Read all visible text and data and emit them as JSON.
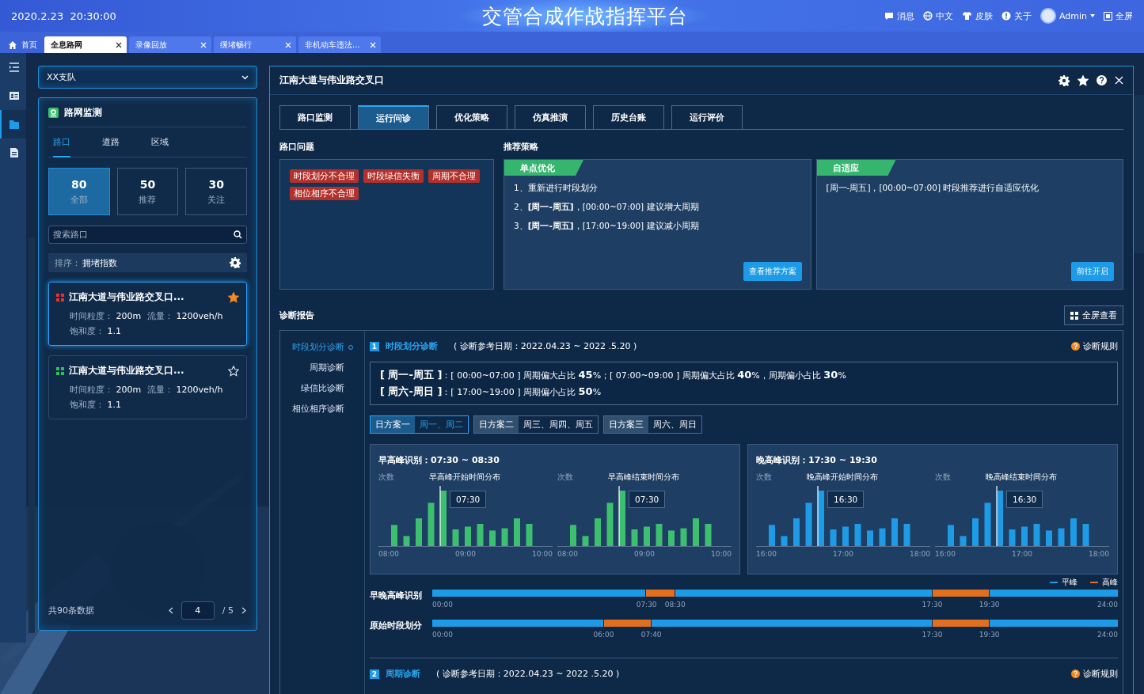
{
  "header": {
    "datetime": "2020.2.23  20:30:00",
    "title": "交管合成作战指挥平台",
    "actions": [
      {
        "kind": "message",
        "label": "消息"
      },
      {
        "kind": "language",
        "label": "中文"
      },
      {
        "kind": "skin",
        "label": "皮肤"
      },
      {
        "kind": "about",
        "label": "关于"
      }
    ],
    "user": "Admin",
    "fullscreen": "全屏"
  },
  "tabs": [
    {
      "kind": "home",
      "label": "首页",
      "selected": false
    },
    {
      "kind": "page",
      "label": "全息路网",
      "selected": true
    },
    {
      "kind": "page",
      "label": "录像回放",
      "selected": false
    },
    {
      "kind": "page",
      "label": "缓堵畅行",
      "selected": false
    },
    {
      "kind": "page",
      "label": "非机动车违法...",
      "selected": false
    }
  ],
  "rail": [
    {
      "kind": "menu",
      "selected": false
    },
    {
      "kind": "card",
      "selected": false
    },
    {
      "kind": "folder",
      "selected": true
    },
    {
      "kind": "doc",
      "selected": false
    }
  ],
  "sidebar": {
    "unit_select": "XX支队",
    "title": "路网监测",
    "subtabs": [
      {
        "label": "路口",
        "selected": true
      },
      {
        "label": "道路",
        "selected": false
      },
      {
        "label": "区域",
        "selected": false
      }
    ],
    "stats": [
      {
        "value": "80",
        "label": "全部",
        "selected": true
      },
      {
        "value": "50",
        "label": "推荐",
        "selected": false
      },
      {
        "value": "30",
        "label": "关注",
        "selected": false
      }
    ],
    "search": {
      "placeholder": "搜索路口"
    },
    "sort_label": "排序：",
    "sort_value": "拥堵指数",
    "items": [
      {
        "name": "江南大道与伟业路交叉口...",
        "color": "#e8322a",
        "starred": true,
        "selected": true,
        "fields": [
          {
            "label": "时间粒度：",
            "value": "200m"
          },
          {
            "label": "流量：",
            "value": "1200veh/h"
          },
          {
            "label": "饱和度：",
            "value": "1.1"
          }
        ]
      },
      {
        "name": "江南大道与伟业路交叉口...",
        "color": "#2fbf5f",
        "starred": false,
        "selected": false,
        "fields": [
          {
            "label": "时间粒度：",
            "value": "200m"
          },
          {
            "label": "流量：",
            "value": "1200veh/h"
          },
          {
            "label": "饱和度：",
            "value": "1.1"
          }
        ]
      }
    ],
    "footer": {
      "total": "共90条数据",
      "page": "4",
      "pages": "/ 5"
    }
  },
  "panel": {
    "title": "江南大道与伟业路交叉口",
    "tabs": [
      {
        "label": "路口监测",
        "selected": false
      },
      {
        "label": "运行问诊",
        "selected": true
      },
      {
        "label": "优化策略",
        "selected": false
      },
      {
        "label": "仿真推演",
        "selected": false
      },
      {
        "label": "历史台账",
        "selected": false
      },
      {
        "label": "运行评价",
        "selected": false
      }
    ],
    "problems": {
      "title": "路口问题",
      "tags": [
        "时段划分不合理",
        "时段绿信失衡",
        "周期不合理",
        "相位相序不合理"
      ]
    },
    "strategies": {
      "title": "推荐策略",
      "cards": [
        {
          "title": "单点优化",
          "lines": [
            "1、重新进行时段划分",
            "2、**[周一-周五]**，[00:00~07:00] 建议增大周期",
            "3、**[周一-周五]**，[17:00~19:00] 建议减小周期"
          ],
          "button": "查看推荐方案"
        },
        {
          "title": "自适应",
          "lines": [
            "[周一-周五]，[00:00~07:00] 时段推荐进行自适应优化"
          ],
          "button": "前往开启"
        }
      ]
    },
    "report": {
      "title": "诊断报告",
      "fullscreen": "全屏查看",
      "nav": [
        {
          "label": "时段划分诊断",
          "selected": true
        },
        {
          "label": "周期诊断",
          "selected": false
        },
        {
          "label": "绿信比诊断",
          "selected": false
        },
        {
          "label": "相位相序诊断",
          "selected": false
        }
      ],
      "sections": [
        {
          "index": "1",
          "title": "时段划分诊断",
          "date": "( 诊断参考日期：2022.04.23 ~ 2022 .5.20 )",
          "rule": "诊断规则",
          "summary": [
            "**[ 周一-周五 ]**：[ 00:00~07:00 ] 周期偏大占比 **45**%；[ 07:00~09:00 ] 周期偏大占比 **40**%，周期偏小占比 **30**%",
            "**[ 周六-周日 ]**：[ 17:00~19:00 ] 周期偏小占比 **50**%"
          ],
          "plans": [
            {
              "name": "日方案一",
              "days": "周一、周二",
              "selected": true
            },
            {
              "name": "日方案二",
              "days": "周三、周四、周五",
              "selected": false
            },
            {
              "name": "日方案三",
              "days": "周六、周日",
              "selected": false
            }
          ],
          "peaks": [
            {
              "title": "早高峰识别：07:30 ~ 08:30",
              "color": "#3cc070",
              "charts": [
                {
                  "ylabel": "次数",
                  "title": "早高峰开始时间分布",
                  "marker": "07:30",
                  "xticks": [
                    "08:00",
                    "09:00",
                    "10:00"
                  ]
                },
                {
                  "ylabel": "次数",
                  "title": "早高峰结束时间分布",
                  "marker": "07:30",
                  "xticks": [
                    "08:00",
                    "09:00",
                    "10:00"
                  ]
                }
              ]
            },
            {
              "title": "晚高峰识别：17:30 ~ 19:30",
              "color": "#1e9be6",
              "charts": [
                {
                  "ylabel": "次数",
                  "title": "晚高峰开始时间分布",
                  "marker": "16:30",
                  "xticks": [
                    "16:00",
                    "17:00",
                    "18:00"
                  ]
                },
                {
                  "ylabel": "次数",
                  "title": "晚高峰结束时间分布",
                  "marker": "16:30",
                  "xticks": [
                    "16:00",
                    "17:00",
                    "18:00"
                  ]
                }
              ]
            }
          ],
          "legend": [
            {
              "kind": "flat",
              "label": "平峰"
            },
            {
              "kind": "peak",
              "label": "高峰"
            }
          ],
          "timelines": [
            {
              "label": "早晚高峰识别",
              "ticks": [
                "00:00",
                "07:30",
                "08:30",
                "17:30",
                "19:30",
                "24:00"
              ],
              "segments": [
                {
                  "kind": "flat"
                },
                {
                  "kind": "peak"
                },
                {
                  "kind": "flat"
                },
                {
                  "kind": "peak"
                },
                {
                  "kind": "flat"
                }
              ]
            },
            {
              "label": "原始时段划分",
              "ticks": [
                "00:00",
                "06:00",
                "07:40",
                "17:30",
                "19:30",
                "24:00"
              ],
              "segments": [
                {
                  "kind": "flat"
                },
                {
                  "kind": "peak"
                },
                {
                  "kind": "flat"
                },
                {
                  "kind": "peak"
                },
                {
                  "kind": "flat"
                }
              ]
            }
          ]
        },
        {
          "index": "2",
          "title": "周期诊断",
          "date": "( 诊断参考日期：2022.04.23 ~ 2022 .5.20 )",
          "rule": "诊断规则"
        }
      ]
    }
  }
}
